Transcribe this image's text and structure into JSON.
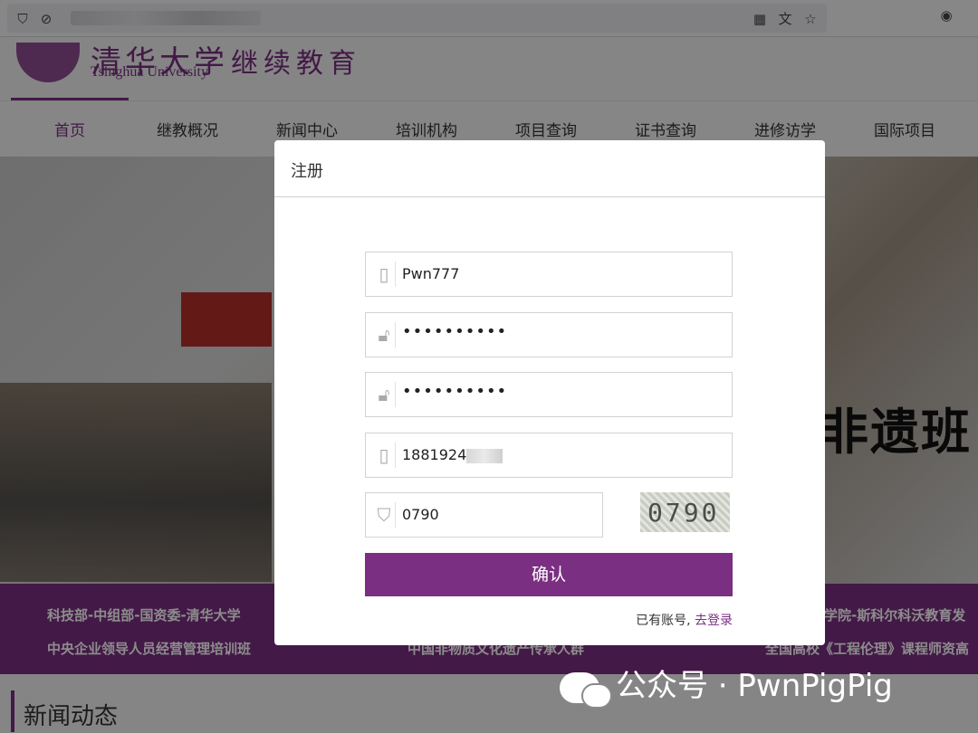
{
  "browser": {
    "url_placeholder": "blurred url"
  },
  "site": {
    "logo_cn": "清华大学",
    "logo_en": "Tsinghua University",
    "logo_sub": "继续教育",
    "nav": [
      "首页",
      "继教概况",
      "新闻中心",
      "培训机构",
      "项目查询",
      "证书查询",
      "进修访学",
      "国际项目"
    ],
    "banner_calligraphy": "非遗班",
    "band_texts": [
      "科技部-中组部-国资委-清华大学",
      "中央企业领导人员经营管理培训班",
      "中国非物质文化遗产传承人群",
      "学院-斯科尔科沃教育发",
      "全国高校《工程伦理》课程师资高"
    ],
    "news_title": "新闻动态"
  },
  "modal": {
    "title": "注册",
    "username": "Pwn777",
    "password": "••••••••••",
    "password_confirm": "••••••••••",
    "phone": "1881924",
    "captcha_input": "0790",
    "captcha_image_text": "0790",
    "confirm_label": "确认",
    "have_account": "已有账号,",
    "login_link": "去登录"
  },
  "watermark": "公众号 · PwnPigPig",
  "colors": {
    "brand_purple": "#7b2f82"
  }
}
